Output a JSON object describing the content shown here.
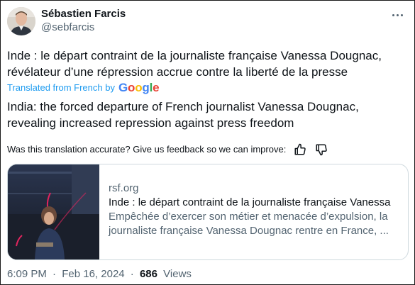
{
  "author": {
    "display_name": "Sébastien Farcis",
    "handle": "@sebfarcis"
  },
  "tweet": {
    "text_line1": "Inde : le départ contraint de la journaliste française Vanessa Dougnac,",
    "text_line2": "révélateur d’une répression accrue contre la liberté de la presse",
    "translated_label": "Translated from French by",
    "translated_by": "Google",
    "translation_line1": "India: the forced departure of French journalist Vanessa Dougnac,",
    "translation_line2": "revealing increased repression against press freedom",
    "feedback_prompt": "Was this translation accurate? Give us feedback so we can improve:"
  },
  "link_card": {
    "domain": "rsf.org",
    "title": "Inde : le départ contraint de la journaliste française Vanessa",
    "description": "Empêchée d’exercer son métier et menacée d’expulsion, la journaliste française Vanessa Dougnac rentre en France, ..."
  },
  "meta": {
    "time": "6:09 PM",
    "separator1": "·",
    "date": "Feb 16, 2024",
    "separator2": "·",
    "views_count": "686",
    "views_label": "Views"
  },
  "icons": {
    "more": "more-dots-icon",
    "thumbs_up": "thumbs-up-icon",
    "thumbs_down": "thumbs-down-icon"
  },
  "colors": {
    "link_blue": "#1d9bf0",
    "secondary_text": "#536471",
    "primary_text": "#0f1419",
    "google_blue": "#4285f4",
    "google_red": "#ea4335",
    "google_yellow": "#fbbc05",
    "google_green": "#34a853"
  }
}
